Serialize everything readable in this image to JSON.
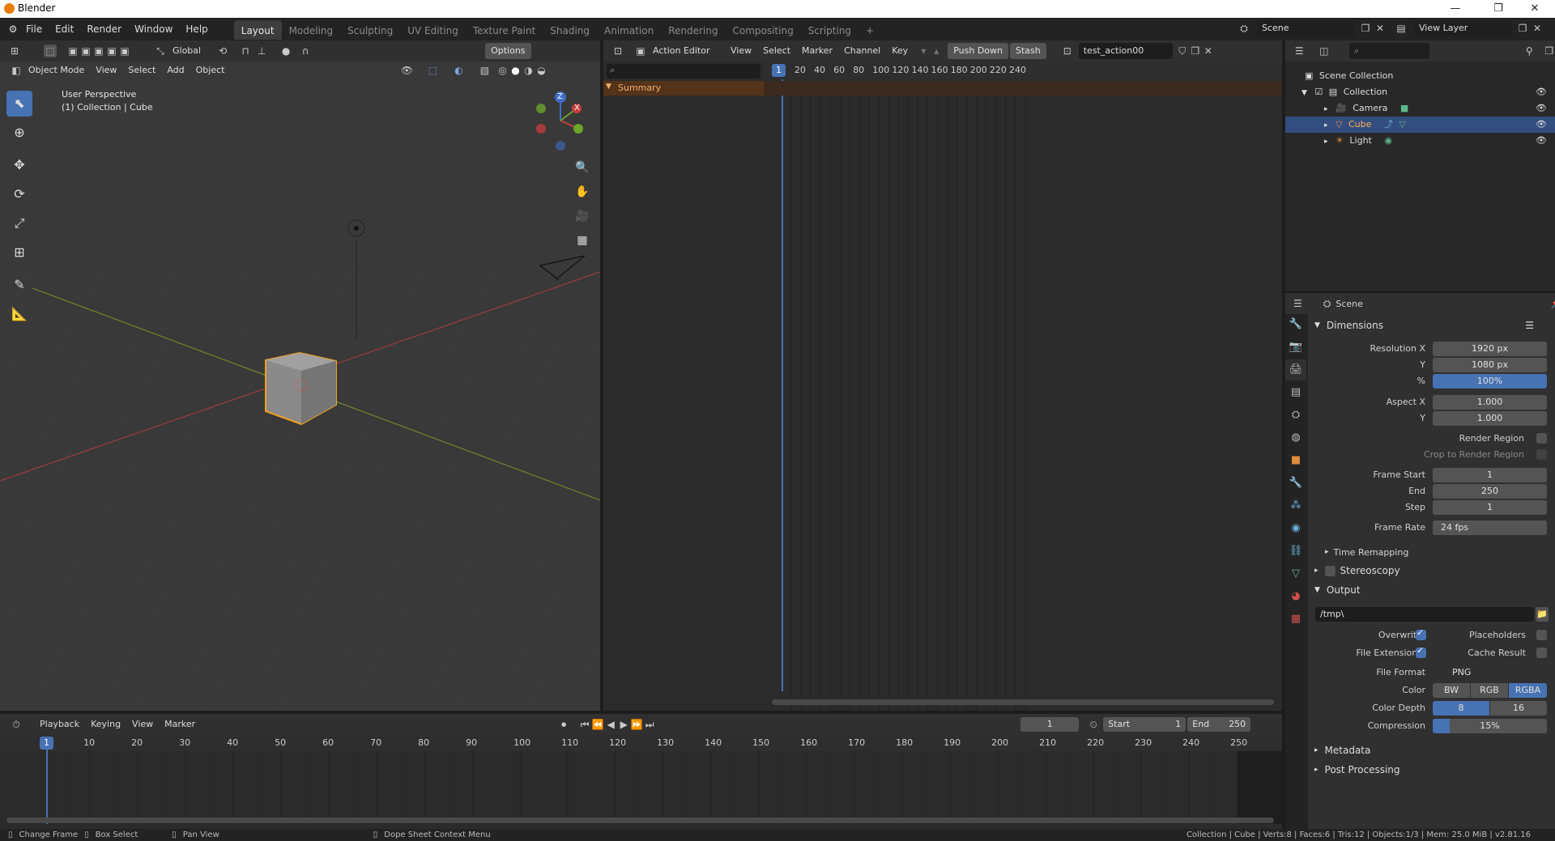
{
  "app": {
    "title": "Blender"
  },
  "window_controls": {
    "minimize": "—",
    "maximize": "❐",
    "close": "✕"
  },
  "menu": [
    "File",
    "Edit",
    "Render",
    "Window",
    "Help"
  ],
  "workspaces": [
    "Layout",
    "Modeling",
    "Sculpting",
    "UV Editing",
    "Texture Paint",
    "Shading",
    "Animation",
    "Rendering",
    "Compositing",
    "Scripting"
  ],
  "workspace_add": "+",
  "scene_field": "Scene",
  "view_layer_field": "View Layer",
  "viewport": {
    "orientation": "Global",
    "options": "Options",
    "mode": "Object Mode",
    "menus": [
      "View",
      "Select",
      "Add",
      "Object"
    ],
    "overlay_title": "User Perspective",
    "overlay_sub": "(1) Collection | Cube",
    "axes": {
      "z": "Z",
      "y": "Y",
      "x": "X"
    }
  },
  "action_editor": {
    "mode": "Action Editor",
    "menus": [
      "View",
      "Select",
      "Marker",
      "Channel",
      "Key"
    ],
    "push_down": "Push Down",
    "stash": "Stash",
    "action_name": "test_action00",
    "summary": "Summary",
    "current_frame": "1",
    "ruler": [
      "20",
      "40",
      "60",
      "80",
      "100",
      "120",
      "140",
      "160",
      "180",
      "200",
      "220",
      "240"
    ]
  },
  "outliner": {
    "root": "Scene Collection",
    "items": [
      {
        "name": "Collection"
      },
      {
        "name": "Camera"
      },
      {
        "name": "Cube"
      },
      {
        "name": "Light"
      }
    ]
  },
  "properties": {
    "context": "Scene",
    "dimensions": {
      "header": "Dimensions",
      "resolution_x_label": "Resolution X",
      "resolution_x": "1920 px",
      "y_label": "Y",
      "resolution_y": "1080 px",
      "pct_label": "%",
      "pct": "100%",
      "aspect_x_label": "Aspect X",
      "aspect_x": "1.000",
      "aspect_y_label": "Y",
      "aspect_y": "1.000",
      "render_region": "Render Region",
      "crop_region": "Crop to Render Region",
      "frame_start_label": "Frame Start",
      "frame_start": "1",
      "end_label": "End",
      "end": "250",
      "step_label": "Step",
      "step": "1",
      "frame_rate_label": "Frame Rate",
      "frame_rate": "24 fps",
      "time_remapping": "Time Remapping"
    },
    "stereoscopy": "Stereoscopy",
    "output": {
      "header": "Output",
      "path": "/tmp\\",
      "overwrite": "Overwrite",
      "placeholders": "Placeholders",
      "file_extensions": "File Extensions",
      "cache_result": "Cache Result",
      "file_format_label": "File Format",
      "file_format": "PNG",
      "color_label": "Color",
      "color_options": [
        "BW",
        "RGB",
        "RGBA"
      ],
      "color_depth_label": "Color Depth",
      "depth_options": [
        "8",
        "16"
      ],
      "compression_label": "Compression",
      "compression": "15%"
    },
    "metadata": "Metadata",
    "post_processing": "Post Processing"
  },
  "timeline": {
    "menus": [
      "Playback",
      "Keying",
      "View",
      "Marker"
    ],
    "current_frame": "1",
    "start_label": "Start",
    "start": "1",
    "end_label": "End",
    "end": "250",
    "ruler": [
      "10",
      "20",
      "30",
      "40",
      "50",
      "60",
      "70",
      "80",
      "90",
      "100",
      "110",
      "120",
      "130",
      "140",
      "150",
      "160",
      "170",
      "180",
      "190",
      "200",
      "210",
      "220",
      "230",
      "240",
      "250"
    ],
    "playhead": "1"
  },
  "statusbar": {
    "change_frame": "Change Frame",
    "box_select": "Box Select",
    "pan_view": "Pan View",
    "context_menu": "Dope Sheet Context Menu",
    "stats": "Collection | Cube | Verts:8 | Faces:6 | Tris:12 | Objects:1/3 | Mem: 25.0 MiB | v2.81.16"
  }
}
